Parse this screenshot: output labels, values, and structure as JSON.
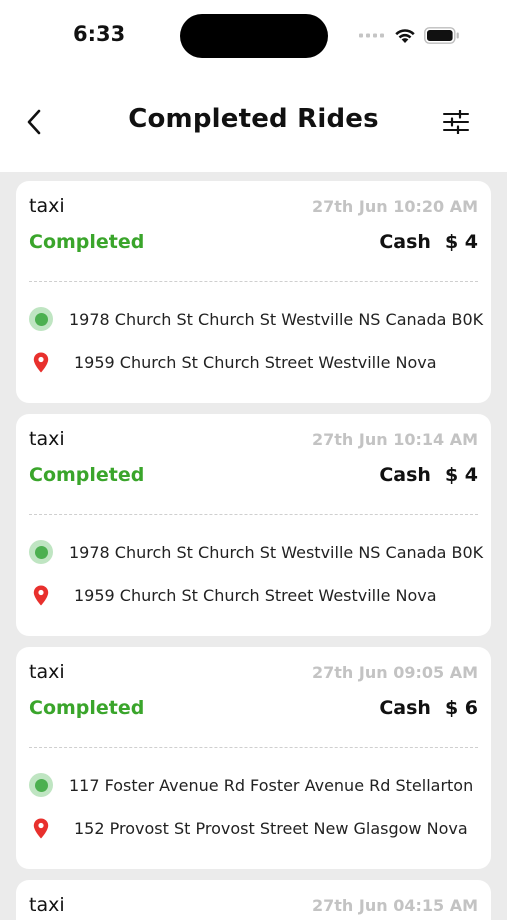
{
  "status_bar": {
    "time": "6:33"
  },
  "header": {
    "title": "Completed Rides"
  },
  "rides": [
    {
      "type": "taxi",
      "date": "27th Jun 10:20 AM",
      "status": "Completed",
      "payment_method": "Cash",
      "amount": "$ 4",
      "pickup": "1978 Church St Church St  Westville NS Canada B0K",
      "drop": "1959 Church St Church Street  Westville Nova"
    },
    {
      "type": "taxi",
      "date": "27th Jun 10:14 AM",
      "status": "Completed",
      "payment_method": "Cash",
      "amount": "$ 4",
      "pickup": "1978 Church St Church St  Westville NS Canada B0K",
      "drop": "1959 Church St Church Street  Westville Nova"
    },
    {
      "type": "taxi",
      "date": "27th Jun 09:05 AM",
      "status": "Completed",
      "payment_method": "Cash",
      "amount": "$ 6",
      "pickup": "117 Foster Avenue Rd Foster Avenue Rd  Stellarton",
      "drop": "152 Provost St Provost Street  New Glasgow Nova"
    },
    {
      "type": "taxi",
      "date": "27th Jun 04:15 AM"
    }
  ],
  "colors": {
    "status_completed": "#3aa52b",
    "pickup_marker": "#4cb050",
    "drop_marker": "#e8302d",
    "date_text": "#c3c3c3"
  },
  "icons": {
    "back": "chevron-left-icon",
    "filter": "sliders-icon",
    "pickup": "green-dot-icon",
    "drop": "map-pin-icon"
  }
}
